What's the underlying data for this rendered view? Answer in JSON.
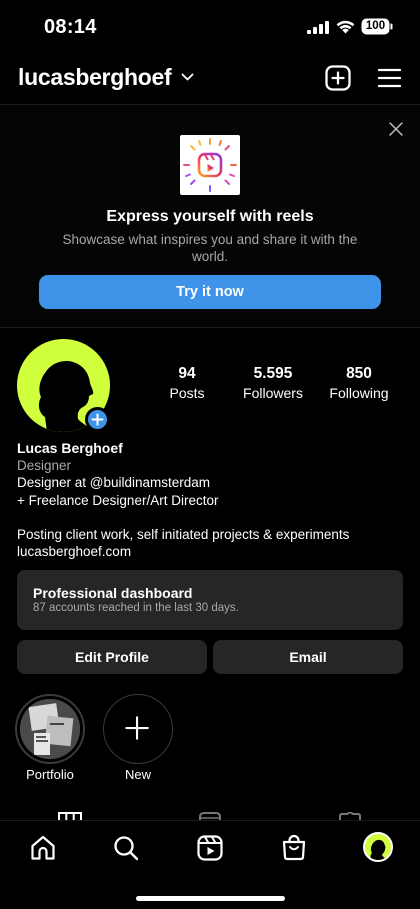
{
  "status_bar": {
    "time": "08:14",
    "battery": "100"
  },
  "header": {
    "username": "lucasberghoef"
  },
  "promo": {
    "title": "Express yourself with reels",
    "subtitle": "Showcase what inspires you and share it with the world.",
    "button": "Try it now"
  },
  "profile": {
    "stats": [
      {
        "value": "94",
        "label": "Posts"
      },
      {
        "value": "5.595",
        "label": "Followers"
      },
      {
        "value": "850",
        "label": "Following"
      }
    ],
    "name": "Lucas Berghoef",
    "category": "Designer",
    "bio_lines": [
      "Designer at @buildinamsterdam",
      "+ Freelance Designer/Art Director",
      "Posting client work, self initiated projects & experiments"
    ],
    "link": "lucasberghoef.com"
  },
  "dashboard": {
    "title": "Professional dashboard",
    "subtitle": "87 accounts reached in the last 30 days."
  },
  "actions": {
    "edit": "Edit Profile",
    "email": "Email"
  },
  "highlights": [
    {
      "label": "Portfolio"
    },
    {
      "label": "New"
    }
  ],
  "colors": {
    "accent": "#3f94e9",
    "avatar_bg": "#cfff3d",
    "background": "#000000",
    "card": "#262626"
  },
  "icons": [
    "home-icon",
    "search-icon",
    "reels-icon",
    "shop-icon",
    "profile-avatar-icon"
  ]
}
